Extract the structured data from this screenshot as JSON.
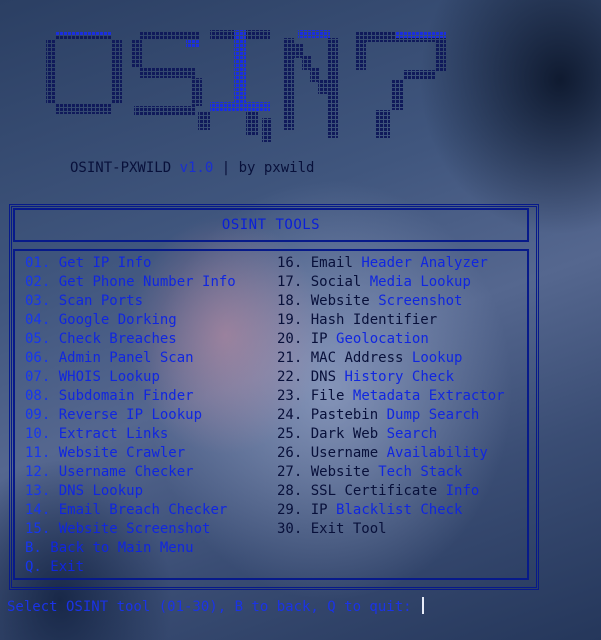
{
  "banner": {
    "logo_text": "OSINT",
    "version_prefix": "OSINT-PXWILD ",
    "version": "v1.0",
    "author": " | by pxwild"
  },
  "panel": {
    "title": "OSINT TOOLS"
  },
  "menu": {
    "left": [
      {
        "num": "01.",
        "label": "Get IP Info"
      },
      {
        "num": "02.",
        "label": "Get Phone Number Info"
      },
      {
        "num": "03.",
        "label": "Scan Ports"
      },
      {
        "num": "04.",
        "label": "Google Dorking"
      },
      {
        "num": "05.",
        "label": "Check Breaches"
      },
      {
        "num": "06.",
        "label": "Admin Panel Scan"
      },
      {
        "num": "07.",
        "label": "WHOIS Lookup"
      },
      {
        "num": "08.",
        "label": "Subdomain Finder"
      },
      {
        "num": "09.",
        "label": "Reverse IP Lookup"
      },
      {
        "num": "10.",
        "label": "Extract Links"
      },
      {
        "num": "11.",
        "label": "Website Crawler"
      },
      {
        "num": "12.",
        "label": "Username Checker"
      },
      {
        "num": "13.",
        "label": "DNS Lookup"
      },
      {
        "num": "14.",
        "label": "Email Breach Checker"
      },
      {
        "num": "15.",
        "label": "Website Screenshot"
      },
      {
        "num": "B.",
        "label": "Back to Main Menu"
      },
      {
        "num": "Q.",
        "label": "Exit"
      }
    ],
    "right": [
      {
        "num": "16.",
        "w": "Email",
        "b": "Header Analyzer"
      },
      {
        "num": "17.",
        "w": "Social",
        "b": "Media Lookup"
      },
      {
        "num": "18.",
        "w": "Website",
        "b": "Screenshot"
      },
      {
        "num": "19.",
        "w": "Hash Identifier",
        "b": ""
      },
      {
        "num": "20.",
        "w": "IP",
        "b": "Geolocation"
      },
      {
        "num": "21.",
        "w": "MAC Address",
        "b": "Lookup"
      },
      {
        "num": "22.",
        "w": "DNS",
        "b": "History Check"
      },
      {
        "num": "23.",
        "w": "File",
        "b": "Metadata Extractor"
      },
      {
        "num": "24.",
        "w": "Pastebin",
        "b": "Dump Search"
      },
      {
        "num": "25.",
        "w": "Dark Web",
        "b": "Search"
      },
      {
        "num": "26.",
        "w": "Username",
        "b": "Availability"
      },
      {
        "num": "27.",
        "w": "Website",
        "b": "Tech Stack"
      },
      {
        "num": "28.",
        "w": "SSL Certificate",
        "b": "Info"
      },
      {
        "num": "29.",
        "w": "IP",
        "b": "Blacklist Check"
      },
      {
        "num": "30.",
        "w": "Exit Tool",
        "b": ""
      }
    ]
  },
  "prompt": {
    "text": "Select OSINT tool (01-30), B to back, Q to quit: "
  },
  "colors": {
    "accent_blue": "#1026e0",
    "dark_text": "#08103a",
    "border": "#071a8a"
  },
  "icons": {
    "cursor": "text-cursor"
  }
}
